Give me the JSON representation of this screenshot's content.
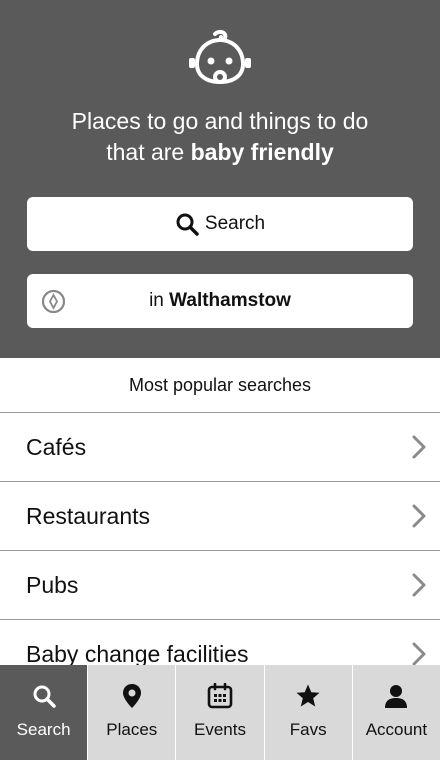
{
  "hero": {
    "tagline_line1": "Places to go and things to do",
    "tagline_prefix": "that are ",
    "tagline_emphasis": "baby friendly",
    "search_button_label": "Search",
    "location_prefix": "in ",
    "location_name": "Walthamstow"
  },
  "popular": {
    "title": "Most popular searches",
    "items": [
      {
        "label": "Cafés"
      },
      {
        "label": "Restaurants"
      },
      {
        "label": "Pubs"
      },
      {
        "label": "Baby change facilities"
      }
    ]
  },
  "tabs": [
    {
      "label": "Search",
      "icon": "search-icon",
      "active": true
    },
    {
      "label": "Places",
      "icon": "map-pin-icon",
      "active": false
    },
    {
      "label": "Events",
      "icon": "calendar-icon",
      "active": false
    },
    {
      "label": "Favs",
      "icon": "star-icon",
      "active": false
    },
    {
      "label": "Account",
      "icon": "user-icon",
      "active": false
    }
  ],
  "colors": {
    "hero_bg": "#5a5a5a",
    "tabbar_bg": "#d9d9d9",
    "active_tab_bg": "#5a5a5a",
    "divider": "#9a9a9a"
  }
}
